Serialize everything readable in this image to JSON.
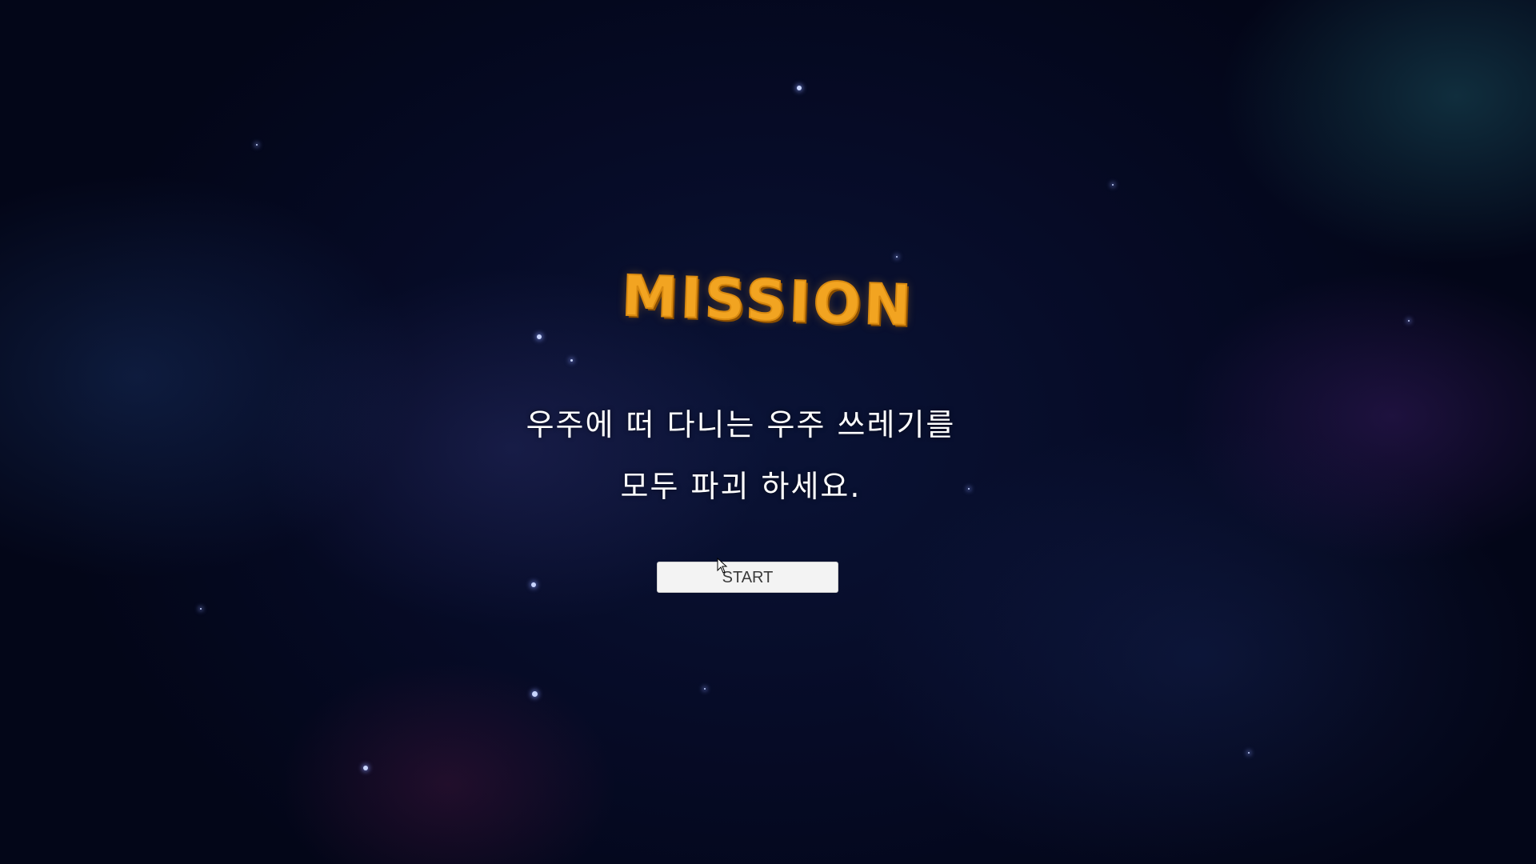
{
  "mission_screen": {
    "title": "MISSION",
    "line_1": "우주에 떠 다니는 우주 쓰레기를",
    "line_2": "모두 파괴 하세요.",
    "start_label": "START"
  },
  "colors": {
    "title": "#f2a421",
    "title_shadow": "#8a4e00",
    "text": "#ffffff",
    "button_bg": "#f3f3f3",
    "button_text": "#3a3a3a",
    "space_bg": "#050a1f"
  }
}
